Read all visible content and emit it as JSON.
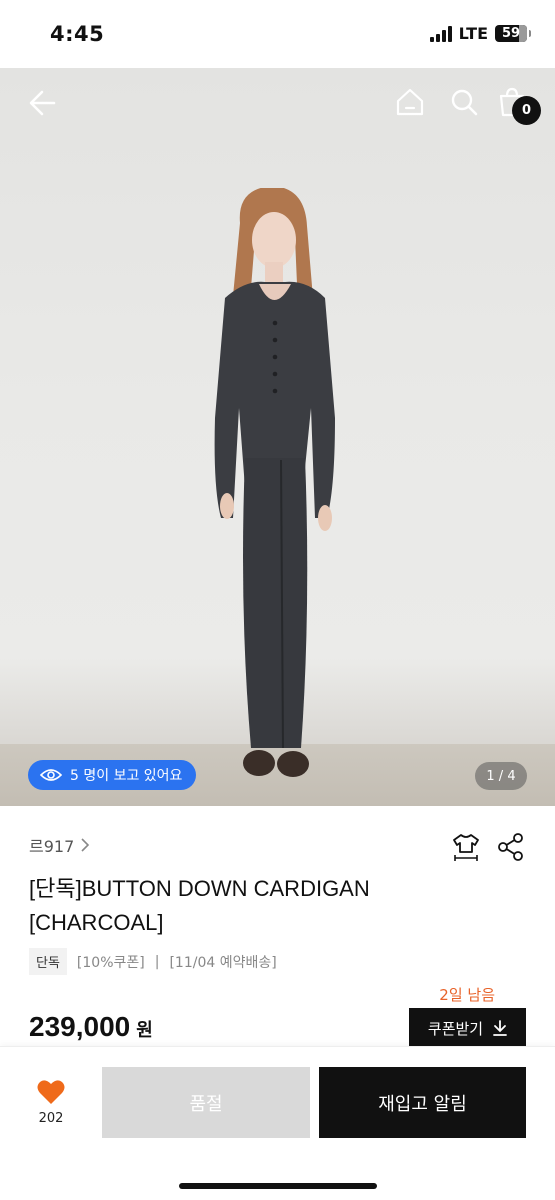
{
  "status": {
    "time": "4:45",
    "network": "LTE",
    "battery": "59"
  },
  "nav": {
    "cart_count": "0"
  },
  "gallery": {
    "viewers_text": "5 명이 보고 있어요",
    "pager": "1 / 4"
  },
  "product": {
    "brand": "르917",
    "title": "[단독]BUTTON DOWN CARDIGAN [CHARCOAL]",
    "tag_exclusive": "단독",
    "tag_coupon": "[10%쿠폰]",
    "tag_separator": "|",
    "tag_shipping": "[11/04 예약배송]",
    "days_left": "2일 남음",
    "price": "239,000",
    "price_unit": "원",
    "coupon_label": "쿠폰받기"
  },
  "bottom": {
    "like_count": "202",
    "soldout_label": "품절",
    "restock_label": "재입고 알림"
  },
  "colors": {
    "accent_blue": "#2b73f0",
    "heart": "#ef6a1a",
    "days_left": "#e8632a"
  }
}
